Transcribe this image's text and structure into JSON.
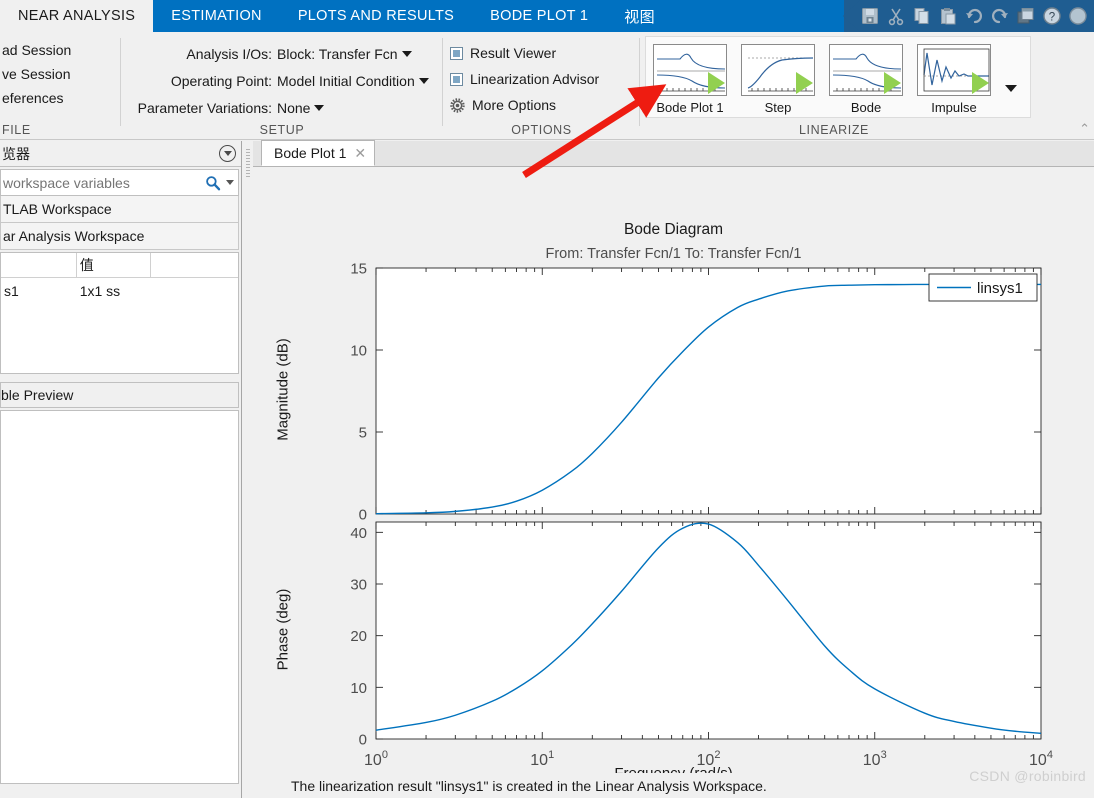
{
  "ribbon": {
    "tabs": [
      {
        "label": "NEAR ANALYSIS",
        "active": true
      },
      {
        "label": "ESTIMATION",
        "active": false
      },
      {
        "label": "PLOTS AND RESULTS",
        "active": false
      },
      {
        "label": "BODE PLOT 1",
        "active": false
      },
      {
        "label": "视图",
        "active": false
      }
    ],
    "quick_access": [
      {
        "name": "save-icon",
        "label": "Save"
      },
      {
        "name": "cut-icon",
        "label": "Cut"
      },
      {
        "name": "copy-icon",
        "label": "Copy"
      },
      {
        "name": "paste-icon",
        "label": "Paste"
      },
      {
        "name": "undo-icon",
        "label": "Undo"
      },
      {
        "name": "redo-icon",
        "label": "Redo"
      },
      {
        "name": "layout-icon",
        "label": "Layout"
      },
      {
        "name": "help-icon",
        "label": "Help"
      }
    ],
    "groups": {
      "file": {
        "label": "FILE",
        "items": [
          "ad Session",
          "ve Session",
          "eferences"
        ]
      },
      "setup": {
        "label": "SETUP",
        "rows": [
          {
            "label": "Analysis I/Os:",
            "value": "Block: Transfer Fcn"
          },
          {
            "label": "Operating Point:",
            "value": "Model Initial Condition"
          },
          {
            "label": "Parameter Variations:",
            "value": "None"
          }
        ]
      },
      "options": {
        "label": "OPTIONS",
        "items": [
          {
            "label": "Result Viewer",
            "icon": "checkbox-icon"
          },
          {
            "label": "Linearization Advisor",
            "icon": "checkbox-icon"
          },
          {
            "label": "More Options",
            "icon": "gear-icon"
          }
        ]
      },
      "linearize": {
        "label": "LINEARIZE",
        "buttons": [
          {
            "label": "Bode Plot 1",
            "icon": "bode-thumb-icon"
          },
          {
            "label": "Step",
            "icon": "step-thumb-icon"
          },
          {
            "label": "Bode",
            "icon": "bode-thumb-icon"
          },
          {
            "label": "Impulse",
            "icon": "impulse-thumb-icon"
          }
        ],
        "more": "▼"
      }
    },
    "collapse_glyph": "⌃"
  },
  "left_panel": {
    "title": "览器",
    "collapse_icon": "circle-caret-icon",
    "search": {
      "placeholder": "workspace variables",
      "value": "",
      "icon": "search-icon"
    },
    "workspaces": [
      "TLAB Workspace",
      "ar Analysis Workspace"
    ],
    "table": {
      "columns": [
        "",
        "值",
        ""
      ],
      "rows": [
        [
          "s1",
          "1x1 ss",
          ""
        ]
      ]
    },
    "preview_label": "ble Preview"
  },
  "document": {
    "tab_label": "Bode Plot 1",
    "close_glyph": "✕"
  },
  "status": {
    "message": "The linearization result \"linsys1\" is created in the Linear Analysis Workspace."
  },
  "watermark": "CSDN @robinbird",
  "colors": {
    "ribbon_blue": "#0071c1",
    "qat_blue": "#1f5d91",
    "line_blue": "#0072BD",
    "arrow_red": "#ee1c11",
    "panel_gray": "#f0f0f0"
  },
  "chart_data": {
    "type": "line",
    "title": "Bode Diagram",
    "subtitle": "From: Transfer Fcn/1  To: Transfer Fcn/1",
    "xlabel": "Frequency  (rad/s)",
    "xscale": "log",
    "xlim": [
      1,
      10000
    ],
    "xticks": [
      1,
      10,
      100,
      1000,
      10000
    ],
    "xticklabels": [
      "10^0",
      "10^1",
      "10^2",
      "10^3",
      "10^4"
    ],
    "legend": {
      "entries": [
        "linsys1"
      ],
      "position": "top-right"
    },
    "grid": false,
    "subplots": [
      {
        "name": "magnitude",
        "ylabel": "Magnitude (dB)",
        "ylim": [
          0,
          15
        ],
        "yticks": [
          0,
          5,
          10,
          15
        ],
        "series": [
          {
            "name": "linsys1",
            "color": "#0072BD",
            "x": [
              1,
              2,
              3,
              5,
              7,
              10,
              15,
              20,
              30,
              50,
              70,
              100,
              150,
              200,
              300,
              500,
              700,
              1000,
              1500,
              2000,
              3000,
              5000,
              7000,
              10000
            ],
            "y": [
              0.02,
              0.07,
              0.16,
              0.42,
              0.78,
              1.45,
              2.6,
              3.7,
              5.6,
              8.3,
              9.9,
              11.4,
              12.6,
              13.1,
              13.6,
              13.9,
              13.95,
              13.98,
              13.99,
              14.0,
              14.0,
              14.0,
              14.0,
              14.0
            ]
          }
        ]
      },
      {
        "name": "phase",
        "ylabel": "Phase (deg)",
        "ylim": [
          0,
          42
        ],
        "yticks": [
          0,
          10,
          20,
          30,
          40
        ],
        "series": [
          {
            "name": "linsys1",
            "color": "#0072BD",
            "x": [
              1,
              2,
              3,
              5,
              7,
              10,
              15,
              20,
              30,
              50,
              70,
              100,
              150,
              200,
              300,
              500,
              700,
              1000,
              2000,
              3000,
              5000,
              7000,
              10000
            ],
            "y": [
              1.7,
              3.2,
              4.6,
              7.3,
              9.8,
              13.2,
              18.2,
              22.3,
              28.6,
              37.0,
              40.8,
              41.6,
              38.0,
              33.6,
              26.8,
              18.0,
              13.4,
              9.7,
              5.0,
              3.4,
              2.1,
              1.5,
              1.1
            ]
          }
        ]
      }
    ]
  },
  "annotation": {
    "arrow": {
      "name": "red-arrow-annotation",
      "color": "#ee1c11"
    }
  }
}
